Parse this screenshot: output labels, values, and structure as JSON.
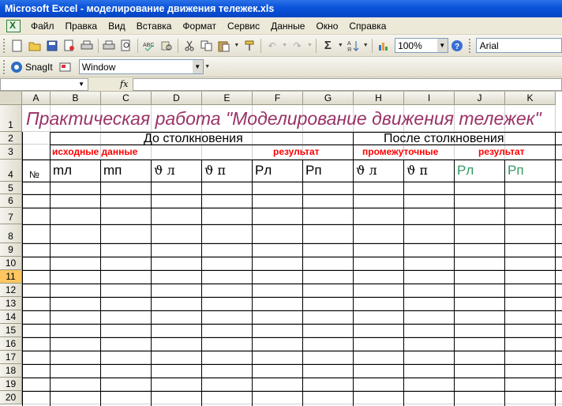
{
  "window": {
    "title": "Microsoft Excel - моделирование  движения тележек.xls"
  },
  "menu": {
    "items": [
      "Файл",
      "Правка",
      "Вид",
      "Вставка",
      "Формат",
      "Сервис",
      "Данные",
      "Окно",
      "Справка"
    ]
  },
  "toolbar": {
    "zoom": "100%",
    "font": "Arial",
    "snagit_label": "SnagIt",
    "window_select": "Window"
  },
  "formula_bar": {
    "fx": "fx"
  },
  "sheet": {
    "columns": [
      "A",
      "B",
      "C",
      "D",
      "E",
      "F",
      "G",
      "H",
      "I",
      "J",
      "K"
    ],
    "rows": [
      "1",
      "2",
      "3",
      "4",
      "5",
      "6",
      "7",
      "8",
      "9",
      "10",
      "11",
      "12",
      "13",
      "14",
      "15",
      "16",
      "17",
      "18",
      "19",
      "20"
    ],
    "selected_row": "11",
    "title": "Практическая работа \"Моделирование движения тележек\"",
    "before_collision": "До столкновения",
    "after_collision": "После столкновения",
    "source_data": "исходные данные",
    "result1": "результат",
    "intermediate": "промежуточные",
    "result2": "результат",
    "num_sign": "№",
    "col_headers": [
      "mл",
      "mп",
      "ϑ л",
      "ϑ п",
      "Рл",
      "Рп",
      "ϑ л",
      "ϑ п",
      "Рл",
      "Рп"
    ],
    "colors": {
      "title": "#993366",
      "red_labels": "#ff0000",
      "green_headers": "#339966",
      "selected_row_header": "#ffc660"
    }
  }
}
